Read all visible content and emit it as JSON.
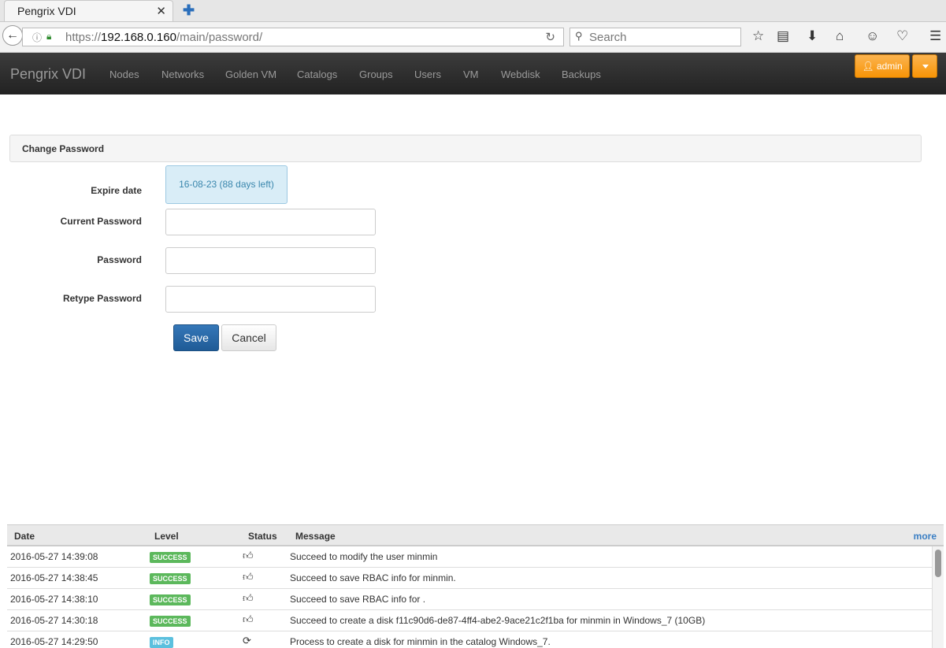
{
  "browser": {
    "tab_title": "Pengrix VDI",
    "url_prefix": "https://",
    "url_host": "192.168.0.160",
    "url_path": "/main/password/",
    "search_placeholder": "Search"
  },
  "app": {
    "brand": "Pengrix VDI",
    "nav": [
      "Nodes",
      "Networks",
      "Golden VM",
      "Catalogs",
      "Groups",
      "Users",
      "VM",
      "Webdisk",
      "Backups"
    ],
    "user_button": "admin"
  },
  "form": {
    "panel_title": "Change Password",
    "expire_label": "Expire date",
    "expire_value": "16-08-23 (88 days left)",
    "current_password_label": "Current Password",
    "password_label": "Password",
    "retype_password_label": "Retype Password",
    "save_label": "Save",
    "cancel_label": "Cancel"
  },
  "log": {
    "headers": {
      "date": "Date",
      "level": "Level",
      "status": "Status",
      "message": "Message",
      "more": "more"
    },
    "rows": [
      {
        "date": "2016-05-27 14:39:08",
        "level": "SUCCESS",
        "message": "Succeed to modify the user minmin"
      },
      {
        "date": "2016-05-27 14:38:45",
        "level": "SUCCESS",
        "message": "Succeed to save RBAC info for minmin."
      },
      {
        "date": "2016-05-27 14:38:10",
        "level": "SUCCESS",
        "message": "Succeed to save RBAC info for ."
      },
      {
        "date": "2016-05-27 14:30:18",
        "level": "SUCCESS",
        "message": "Succeed to create a disk f11c90d6-de87-4ff4-abe2-9ace21c2f1ba for minmin in Windows_7 (10GB)"
      },
      {
        "date": "2016-05-27 14:29:50",
        "level": "INFO",
        "message": "Process to create a disk for minmin in the catalog Windows_7."
      }
    ]
  },
  "colors": {
    "success": "#5cb85c",
    "info": "#5bc0de",
    "accent": "#f89406"
  }
}
